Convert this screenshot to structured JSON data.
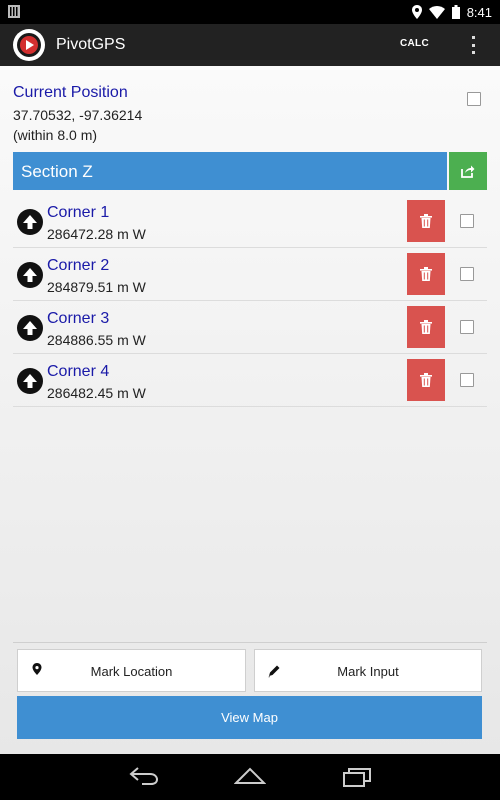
{
  "status_bar": {
    "time": "8:41"
  },
  "action_bar": {
    "title": "PivotGPS",
    "calc_label": "CALC"
  },
  "current_position": {
    "title": "Current Position",
    "coordinates": "37.70532, -97.36214",
    "accuracy": "(within 8.0 m)"
  },
  "section": {
    "title": "Section Z"
  },
  "corners": [
    {
      "name": "Corner 1",
      "distance": "286472.28 m W"
    },
    {
      "name": "Corner 2",
      "distance": "284879.51 m W"
    },
    {
      "name": "Corner 3",
      "distance": "284886.55 m W"
    },
    {
      "name": "Corner 4",
      "distance": "286482.45 m W"
    }
  ],
  "buttons": {
    "mark_location": "Mark Location",
    "mark_input": "Mark Input",
    "view_map": "View Map"
  },
  "icons": {
    "app_logo": "pivotgps-logo-icon",
    "overflow": "overflow-menu-icon",
    "share": "share-icon",
    "corner_direction": "arrow-up-icon",
    "delete": "trash-icon",
    "mark_location": "map-pin-icon",
    "mark_input": "pencil-icon"
  },
  "colors": {
    "accent_blue": "#3f8fd2",
    "share_green": "#4caf50",
    "delete_red": "#d9534f",
    "link_text": "#1a1aa8"
  }
}
